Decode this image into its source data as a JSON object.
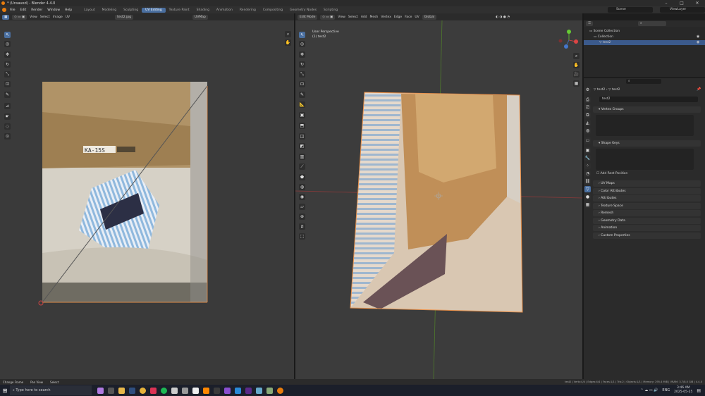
{
  "window": {
    "title": "* (Unsaved) - Blender 4.4.0",
    "controls": [
      "–",
      "□",
      "✕"
    ]
  },
  "menu": [
    "File",
    "Edit",
    "Render",
    "Window",
    "Help"
  ],
  "workspaces": [
    {
      "label": "Layout",
      "active": false
    },
    {
      "label": "Modeling",
      "active": false
    },
    {
      "label": "Sculpting",
      "active": false
    },
    {
      "label": "UV Editing",
      "active": true
    },
    {
      "label": "Texture Paint",
      "active": false
    },
    {
      "label": "Shading",
      "active": false
    },
    {
      "label": "Animation",
      "active": false
    },
    {
      "label": "Rendering",
      "active": false
    },
    {
      "label": "Compositing",
      "active": false
    },
    {
      "label": "Geometry Nodes",
      "active": false
    },
    {
      "label": "Scripting",
      "active": false
    }
  ],
  "scene": {
    "scene_name": "Scene",
    "view_layer": "ViewLayer"
  },
  "uv_header": {
    "menus": [
      "View",
      "Select",
      "Image",
      "UV"
    ],
    "image_name": "test2.jpg",
    "uvmap": "UVMap"
  },
  "vp_header": {
    "mode": "Edit Mode",
    "menus": [
      "View",
      "Select",
      "Add",
      "Mesh",
      "Vertex",
      "Edge",
      "Face",
      "UV"
    ],
    "orientation": "Global",
    "options": "Options"
  },
  "viewport": {
    "line1": "User Perspective",
    "line2": "(1) test2"
  },
  "outliner": {
    "collection_root": "Scene Collection",
    "collection": "Collection",
    "object": "test2"
  },
  "props": {
    "search_placeholder": "",
    "breadcrumb_obj": "test2",
    "breadcrumb_data": "test2",
    "data_name": "test2",
    "vertex_groups": "Vertex Groups",
    "shape_keys": "Shape Keys",
    "add_rest": "Add Rest Position",
    "panels": [
      "UV Maps",
      "Color Attributes",
      "Attributes",
      "Texture Space",
      "Remesh",
      "Geometry Data",
      "Animation",
      "Custom Properties"
    ]
  },
  "status": {
    "left": [
      "Change Frame",
      "Pan View",
      "Select"
    ],
    "right": "test2 | Verts:4/4 | Edges:4/4 | Faces:1/1 | Tris:2 | Objects:1/1 | Memory: 295.4 MiB | VRAM: 3.7/8.0 GiB | 4.4.0"
  },
  "taskbar": {
    "search_placeholder": "Type here to search",
    "lang": "ENG",
    "time": "3:46 AM",
    "date": "2025-05-25"
  },
  "colors": {
    "accent": "#4a6fa0",
    "selection_orange": "#e8904a",
    "bg": "#3a3a3a"
  }
}
